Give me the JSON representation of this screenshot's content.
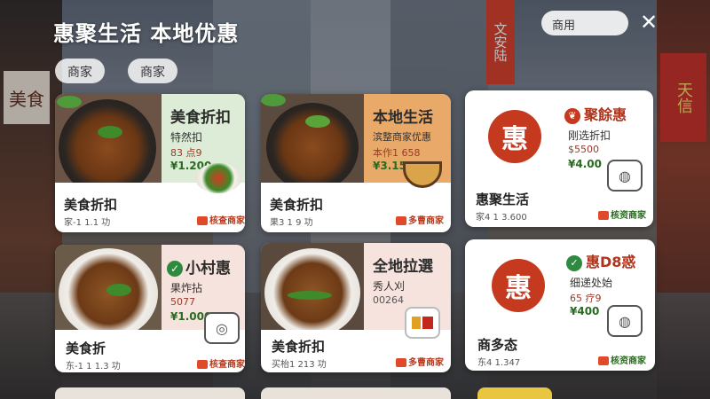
{
  "header": {
    "title": "惠聚生活 本地优惠",
    "search_value": "商用",
    "close_symbol": "✕"
  },
  "background_signs": {
    "left": "美食",
    "right": "天信",
    "middle": "文安陆"
  },
  "filters": [
    {
      "label": "商家"
    },
    {
      "label": "商家"
    }
  ],
  "cards": [
    {
      "panel_title": "美食折扣",
      "panel_sub": "特然扣",
      "panel_old": "83 点9",
      "panel_price": "¥1.200",
      "name": "美食折扣",
      "meta": "家-1 1.1 功",
      "tag": "核查商家"
    },
    {
      "panel_title": "本地生活",
      "panel_sub": "滨整商家优惠",
      "panel_old": "本作1 658",
      "panel_price": "¥3.15",
      "name": "美食折扣",
      "meta": "果3 1 9 功",
      "tag": "多曹商家"
    },
    {
      "brand": "聚餘惠",
      "offer_sub": "刚选折扣",
      "offer_old": "$5500",
      "offer_price": "¥4.00",
      "name": "惠聚生活",
      "meta": "家4 1 3.600",
      "tag": "核资商家"
    },
    {
      "panel_title": "小村惠",
      "panel_sub": "果炸拈",
      "panel_old": "5077",
      "panel_price": "¥1.000",
      "name": "美食折",
      "meta": "东-1 1 1.3 功",
      "tag": "核查商家"
    },
    {
      "panel_title": "全地拉選",
      "panel_sub": "秀人刈",
      "panel_old": "00264",
      "panel_price": "",
      "name": "美食折扣",
      "meta": "买枱1 213 功",
      "tag": "多曹商家"
    },
    {
      "brand": "惠D8惑",
      "offer_sub": "细递处始",
      "offer_old": "65 疗9",
      "offer_price": "¥400",
      "name": "商多态",
      "meta": "东4 1.347",
      "tag": "核资商家"
    }
  ],
  "logo_char": "惠",
  "colors": {
    "brand_red": "#c5391e",
    "price_green": "#2a6a20",
    "panel_green": "#dcecd6",
    "panel_orange": "#e9a969",
    "panel_pink": "#f7e3dd"
  }
}
